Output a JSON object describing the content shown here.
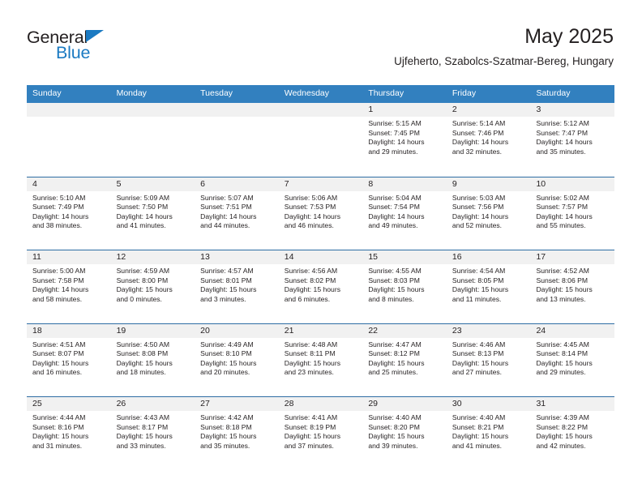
{
  "logo": {
    "word_one": "General",
    "word_two": "Blue",
    "triangle_color": "#1b7ac2",
    "text_color": "#231f20"
  },
  "header": {
    "title": "May 2025",
    "subtitle": "Ujfeherto, Szabolcs-Szatmar-Bereg, Hungary"
  },
  "theme": {
    "header_blue": "#3280bf",
    "rule_blue": "#2e6da4",
    "daynum_band": "#f1f1f1"
  },
  "weekdays": [
    "Sunday",
    "Monday",
    "Tuesday",
    "Wednesday",
    "Thursday",
    "Friday",
    "Saturday"
  ],
  "weeks": [
    [
      {
        "day": "",
        "lines": []
      },
      {
        "day": "",
        "lines": []
      },
      {
        "day": "",
        "lines": []
      },
      {
        "day": "",
        "lines": []
      },
      {
        "day": "1",
        "lines": [
          "Sunrise: 5:15 AM",
          "Sunset: 7:45 PM",
          "Daylight: 14 hours",
          "and 29 minutes."
        ]
      },
      {
        "day": "2",
        "lines": [
          "Sunrise: 5:14 AM",
          "Sunset: 7:46 PM",
          "Daylight: 14 hours",
          "and 32 minutes."
        ]
      },
      {
        "day": "3",
        "lines": [
          "Sunrise: 5:12 AM",
          "Sunset: 7:47 PM",
          "Daylight: 14 hours",
          "and 35 minutes."
        ]
      }
    ],
    [
      {
        "day": "4",
        "lines": [
          "Sunrise: 5:10 AM",
          "Sunset: 7:49 PM",
          "Daylight: 14 hours",
          "and 38 minutes."
        ]
      },
      {
        "day": "5",
        "lines": [
          "Sunrise: 5:09 AM",
          "Sunset: 7:50 PM",
          "Daylight: 14 hours",
          "and 41 minutes."
        ]
      },
      {
        "day": "6",
        "lines": [
          "Sunrise: 5:07 AM",
          "Sunset: 7:51 PM",
          "Daylight: 14 hours",
          "and 44 minutes."
        ]
      },
      {
        "day": "7",
        "lines": [
          "Sunrise: 5:06 AM",
          "Sunset: 7:53 PM",
          "Daylight: 14 hours",
          "and 46 minutes."
        ]
      },
      {
        "day": "8",
        "lines": [
          "Sunrise: 5:04 AM",
          "Sunset: 7:54 PM",
          "Daylight: 14 hours",
          "and 49 minutes."
        ]
      },
      {
        "day": "9",
        "lines": [
          "Sunrise: 5:03 AM",
          "Sunset: 7:56 PM",
          "Daylight: 14 hours",
          "and 52 minutes."
        ]
      },
      {
        "day": "10",
        "lines": [
          "Sunrise: 5:02 AM",
          "Sunset: 7:57 PM",
          "Daylight: 14 hours",
          "and 55 minutes."
        ]
      }
    ],
    [
      {
        "day": "11",
        "lines": [
          "Sunrise: 5:00 AM",
          "Sunset: 7:58 PM",
          "Daylight: 14 hours",
          "and 58 minutes."
        ]
      },
      {
        "day": "12",
        "lines": [
          "Sunrise: 4:59 AM",
          "Sunset: 8:00 PM",
          "Daylight: 15 hours",
          "and 0 minutes."
        ]
      },
      {
        "day": "13",
        "lines": [
          "Sunrise: 4:57 AM",
          "Sunset: 8:01 PM",
          "Daylight: 15 hours",
          "and 3 minutes."
        ]
      },
      {
        "day": "14",
        "lines": [
          "Sunrise: 4:56 AM",
          "Sunset: 8:02 PM",
          "Daylight: 15 hours",
          "and 6 minutes."
        ]
      },
      {
        "day": "15",
        "lines": [
          "Sunrise: 4:55 AM",
          "Sunset: 8:03 PM",
          "Daylight: 15 hours",
          "and 8 minutes."
        ]
      },
      {
        "day": "16",
        "lines": [
          "Sunrise: 4:54 AM",
          "Sunset: 8:05 PM",
          "Daylight: 15 hours",
          "and 11 minutes."
        ]
      },
      {
        "day": "17",
        "lines": [
          "Sunrise: 4:52 AM",
          "Sunset: 8:06 PM",
          "Daylight: 15 hours",
          "and 13 minutes."
        ]
      }
    ],
    [
      {
        "day": "18",
        "lines": [
          "Sunrise: 4:51 AM",
          "Sunset: 8:07 PM",
          "Daylight: 15 hours",
          "and 16 minutes."
        ]
      },
      {
        "day": "19",
        "lines": [
          "Sunrise: 4:50 AM",
          "Sunset: 8:08 PM",
          "Daylight: 15 hours",
          "and 18 minutes."
        ]
      },
      {
        "day": "20",
        "lines": [
          "Sunrise: 4:49 AM",
          "Sunset: 8:10 PM",
          "Daylight: 15 hours",
          "and 20 minutes."
        ]
      },
      {
        "day": "21",
        "lines": [
          "Sunrise: 4:48 AM",
          "Sunset: 8:11 PM",
          "Daylight: 15 hours",
          "and 23 minutes."
        ]
      },
      {
        "day": "22",
        "lines": [
          "Sunrise: 4:47 AM",
          "Sunset: 8:12 PM",
          "Daylight: 15 hours",
          "and 25 minutes."
        ]
      },
      {
        "day": "23",
        "lines": [
          "Sunrise: 4:46 AM",
          "Sunset: 8:13 PM",
          "Daylight: 15 hours",
          "and 27 minutes."
        ]
      },
      {
        "day": "24",
        "lines": [
          "Sunrise: 4:45 AM",
          "Sunset: 8:14 PM",
          "Daylight: 15 hours",
          "and 29 minutes."
        ]
      }
    ],
    [
      {
        "day": "25",
        "lines": [
          "Sunrise: 4:44 AM",
          "Sunset: 8:16 PM",
          "Daylight: 15 hours",
          "and 31 minutes."
        ]
      },
      {
        "day": "26",
        "lines": [
          "Sunrise: 4:43 AM",
          "Sunset: 8:17 PM",
          "Daylight: 15 hours",
          "and 33 minutes."
        ]
      },
      {
        "day": "27",
        "lines": [
          "Sunrise: 4:42 AM",
          "Sunset: 8:18 PM",
          "Daylight: 15 hours",
          "and 35 minutes."
        ]
      },
      {
        "day": "28",
        "lines": [
          "Sunrise: 4:41 AM",
          "Sunset: 8:19 PM",
          "Daylight: 15 hours",
          "and 37 minutes."
        ]
      },
      {
        "day": "29",
        "lines": [
          "Sunrise: 4:40 AM",
          "Sunset: 8:20 PM",
          "Daylight: 15 hours",
          "and 39 minutes."
        ]
      },
      {
        "day": "30",
        "lines": [
          "Sunrise: 4:40 AM",
          "Sunset: 8:21 PM",
          "Daylight: 15 hours",
          "and 41 minutes."
        ]
      },
      {
        "day": "31",
        "lines": [
          "Sunrise: 4:39 AM",
          "Sunset: 8:22 PM",
          "Daylight: 15 hours",
          "and 42 minutes."
        ]
      }
    ]
  ]
}
